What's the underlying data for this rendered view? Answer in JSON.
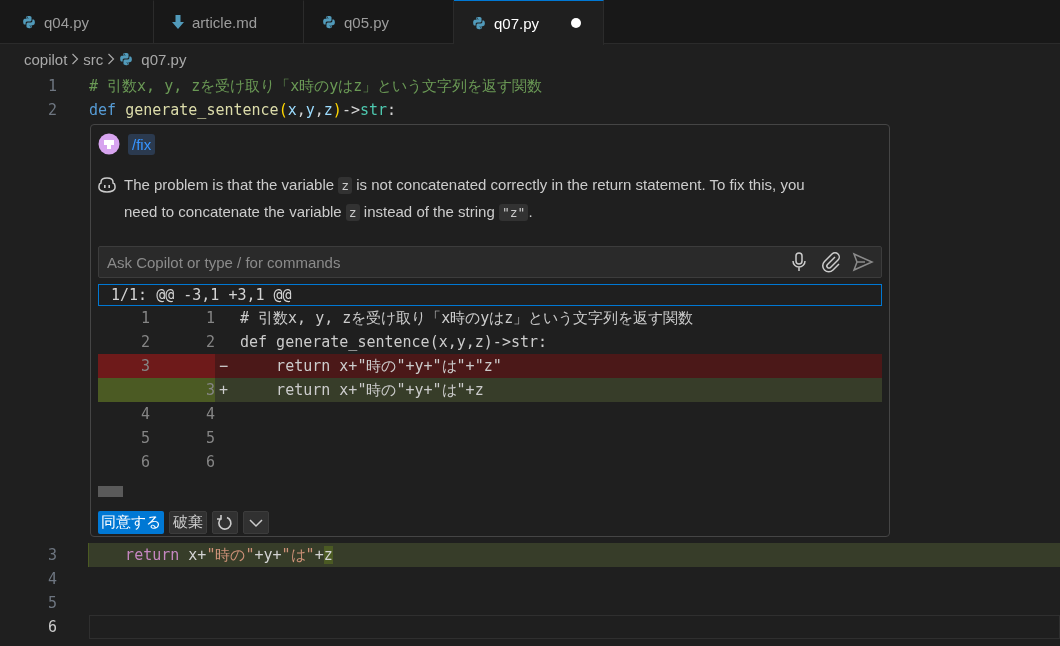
{
  "tabs": [
    {
      "label": "q04.py",
      "kind": "python",
      "selected": false,
      "modified": false
    },
    {
      "label": "article.md",
      "kind": "markdown",
      "selected": false,
      "modified": false
    },
    {
      "label": "q05.py",
      "kind": "python",
      "selected": false,
      "modified": false
    },
    {
      "label": "q07.py",
      "kind": "python",
      "selected": true,
      "modified": true
    }
  ],
  "breadcrumb": [
    {
      "label": "copilot",
      "kind": "folder"
    },
    {
      "label": "src",
      "kind": "folder"
    },
    {
      "label": "q07.py",
      "kind": "python"
    }
  ],
  "lines_before": [
    {
      "number": "1",
      "current": false,
      "added": false,
      "tokens": [
        {
          "text": "# 引数x, y, zを受け取り「x時のyはz」という文字列を返す関数",
          "kind": "comment"
        }
      ]
    },
    {
      "number": "2",
      "current": false,
      "added": false,
      "tokens": [
        {
          "text": "def ",
          "kind": "keyword"
        },
        {
          "text": "generate_sentence",
          "kind": "function"
        },
        {
          "text": "(",
          "kind": "paren"
        },
        {
          "text": "x",
          "kind": "param"
        },
        {
          "text": ",",
          "kind": "plain"
        },
        {
          "text": "y",
          "kind": "param"
        },
        {
          "text": ",",
          "kind": "plain"
        },
        {
          "text": "z",
          "kind": "param"
        },
        {
          "text": ")",
          "kind": "paren"
        },
        {
          "text": "->",
          "kind": "plain"
        },
        {
          "text": "str",
          "kind": "type"
        },
        {
          "text": ":",
          "kind": "plain"
        }
      ]
    }
  ],
  "chat": {
    "command": "/fix",
    "message": [
      {
        "text": "The problem is that the variable ",
        "kind": "text"
      },
      {
        "text": "z",
        "kind": "code"
      },
      {
        "text": " is not concatenated correctly in the return statement. To fix this, you need to concatenate the variable ",
        "kind": "text"
      },
      {
        "text": "z",
        "kind": "code"
      },
      {
        "text": " instead of the string ",
        "kind": "text"
      },
      {
        "text": "\"z\"",
        "kind": "code"
      },
      {
        "text": ".",
        "kind": "text"
      }
    ],
    "input": {
      "placeholder": "Ask Copilot or type / for commands"
    },
    "diff": {
      "header": "1/1: @@ -3,1 +3,1 @@",
      "rows": [
        {
          "kind": "context",
          "old": "1",
          "new": "1",
          "text": "# 引数x, y, zを受け取り「x時のyはz」という文字列を返す関数"
        },
        {
          "kind": "context",
          "old": "2",
          "new": "2",
          "text": "def generate_sentence(x,y,z)->str:"
        },
        {
          "kind": "removed",
          "old": "3",
          "sign": "−",
          "text": "    return x+\"時の\"+y+\"は\"+\"z\""
        },
        {
          "kind": "added",
          "new": "3",
          "sign": "+",
          "text": "    return x+\"時の\"+y+\"は\"+z"
        },
        {
          "kind": "context",
          "old": "4",
          "new": "4"
        },
        {
          "kind": "context",
          "old": "5",
          "new": "5"
        },
        {
          "kind": "context",
          "old": "6",
          "new": "6"
        }
      ]
    },
    "buttons": [
      {
        "label": "同意する",
        "kind": "primary"
      },
      {
        "label": "破棄",
        "kind": "secondary"
      }
    ]
  },
  "lines_after": [
    {
      "number": "3",
      "current": false,
      "added": true,
      "tokens": [
        {
          "text": "    return",
          "kind": "control"
        },
        {
          "text": " x+",
          "kind": "plain"
        },
        {
          "text": "\"時の\"",
          "kind": "string"
        },
        {
          "text": "+y+",
          "kind": "plain"
        },
        {
          "text": "\"は\"",
          "kind": "string"
        },
        {
          "text": "+",
          "kind": "plain"
        },
        {
          "text": "z",
          "kind": "inserted"
        }
      ]
    },
    {
      "number": "4",
      "current": false,
      "added": false
    },
    {
      "number": "5",
      "current": false,
      "added": false
    },
    {
      "number": "6",
      "current": true,
      "added": false
    }
  ]
}
